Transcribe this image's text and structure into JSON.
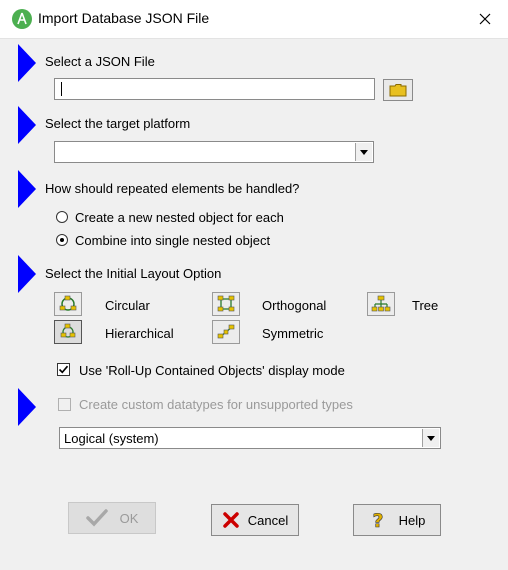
{
  "window": {
    "title": "Import Database JSON File"
  },
  "sections": {
    "json_file": {
      "label": "Select a JSON File",
      "value": ""
    },
    "platform": {
      "label": "Select the target platform",
      "selected": ""
    },
    "repeated": {
      "label": "How should repeated elements be handled?",
      "options": [
        {
          "label": "Create a new nested object for each",
          "checked": false
        },
        {
          "label": "Combine into single nested object",
          "checked": true
        }
      ]
    },
    "layout": {
      "label": "Select the Initial Layout Option",
      "options": {
        "circular": "Circular",
        "orthogonal": "Orthogonal",
        "tree": "Tree",
        "hierarchical": "Hierarchical",
        "symmetric": "Symmetric"
      },
      "rollup_label": "Use 'Roll-Up Contained Objects' display mode",
      "rollup_checked": true
    },
    "datatypes": {
      "label": "Create custom datatypes for unsupported types",
      "checked": false,
      "enabled": false,
      "selected": "Logical (system)"
    }
  },
  "buttons": {
    "ok": "OK",
    "cancel": "Cancel",
    "help": "Help"
  },
  "colors": {
    "accent": "#0000ff",
    "dialog_bg": "#f0f0f0",
    "ok_check": "#a8a8a8",
    "cancel_x": "#cc0000",
    "help_q": "#e0b000",
    "folder": "#e8c020"
  },
  "icons": [
    "app-icon",
    "close-icon",
    "folder-icon",
    "checkmark-icon",
    "x-icon",
    "question-icon"
  ]
}
